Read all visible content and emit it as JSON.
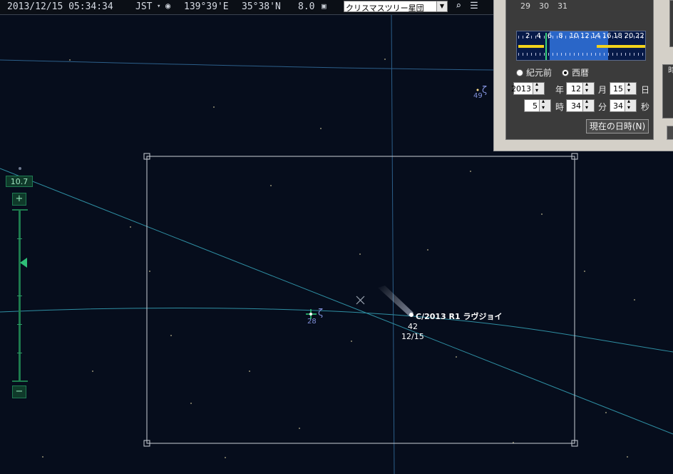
{
  "status": {
    "datetime": "2013/12/15 05:34:34",
    "timezone": "JST",
    "longitude": "139°39'E",
    "latitude": "35°38'N",
    "magnitude_limit": "8.0",
    "target_select": "クリスマスツリー星団"
  },
  "zoom": {
    "value": "10.7",
    "plus": "+",
    "minus": "−",
    "level_fraction": 0.31
  },
  "datepanel": {
    "calendar_tail": [
      "29",
      "30",
      "31"
    ],
    "timeline_hours": [
      "2",
      "4",
      "6",
      "8",
      "10",
      "12",
      "14",
      "16",
      "18",
      "20",
      "22"
    ],
    "era_bc": "紀元前",
    "era_ad": "西暦",
    "selected_era": "西暦",
    "year": "2013",
    "year_unit": "年",
    "month": "12",
    "month_unit": "月",
    "day": "15",
    "day_unit": "日",
    "hour": "5",
    "hour_unit": "時",
    "minute": "34",
    "minute_unit": "分",
    "second": "34",
    "second_unit": "秒",
    "now_button": "現在の日時(N)",
    "side_fragment": "時"
  },
  "sky": {
    "comet_name": "C/2013 R1 ラヴジョイ",
    "comet_mag": "42",
    "comet_date": "12/15",
    "star1_letter": "ζ",
    "star1_number": "28",
    "star2_letter": "ζ",
    "star2_number": "49"
  },
  "colors": {
    "sky": "#060d1c",
    "grid": "#2f8fa3",
    "frame": "#c9ced6",
    "label": "#7f8fd8",
    "zoom": "#1d7a4d"
  }
}
